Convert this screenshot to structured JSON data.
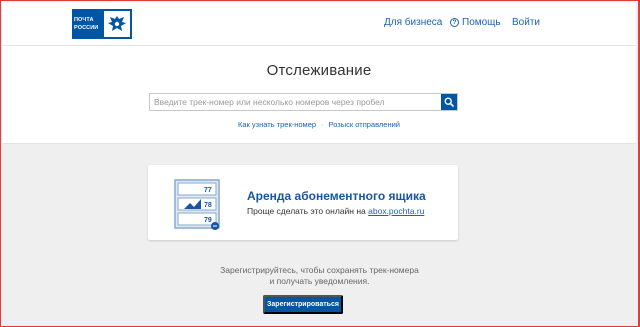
{
  "header": {
    "logo_line1": "ПОЧТА",
    "logo_line2": "РОССИИ",
    "nav_business": "Для бизнеса",
    "nav_help": "Помощь",
    "nav_login": "Войти"
  },
  "main": {
    "title": "Отслеживание",
    "search_placeholder": "Введите трек-номер или несколько номеров через пробел",
    "link_how": "Как узнать трек-номер",
    "link_wanted": "Розыск отправлений"
  },
  "promo": {
    "title": "Аренда абонементного ящика",
    "text_prefix": "Проще сделать это онлайн на",
    "link": "abox.pochta.ru",
    "box_numbers": [
      "77",
      "78",
      "79"
    ]
  },
  "register": {
    "text_line1": "Зарегистрируйтесь, чтобы сохранять трек-номера",
    "text_line2": "и получать уведомления.",
    "button": "Зарегистрироваться"
  },
  "colors": {
    "brand_blue": "#0055a5",
    "link_blue": "#1a63b5",
    "frame_red": "#e23b3b"
  },
  "icons": {
    "search": "search-icon",
    "help": "help-icon",
    "emblem": "eagle-emblem-icon"
  }
}
